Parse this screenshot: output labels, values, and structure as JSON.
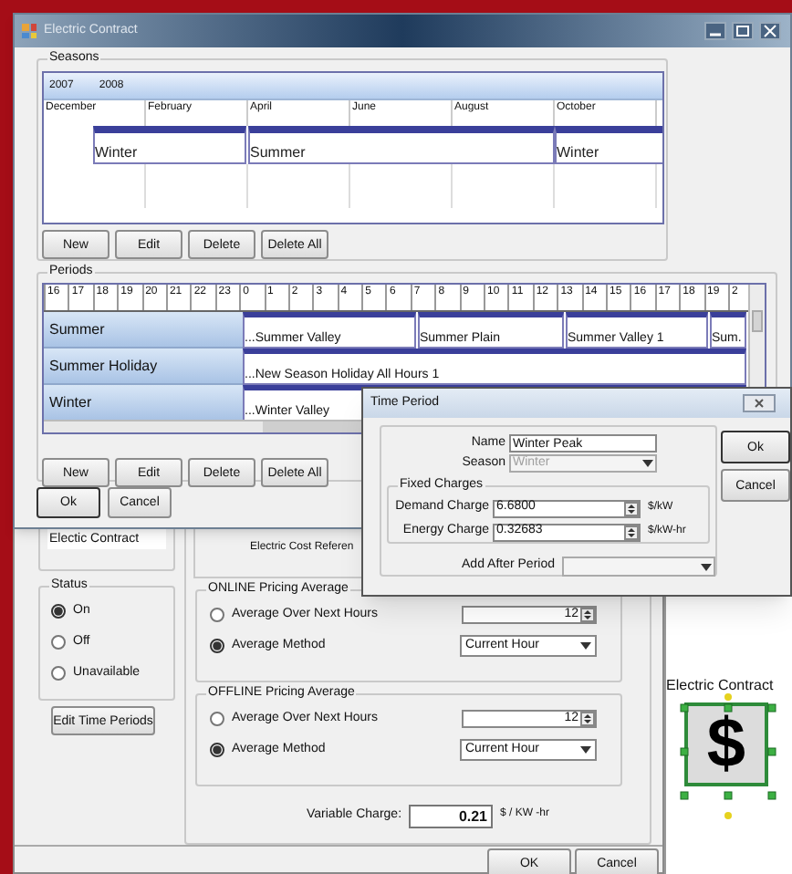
{
  "main_window": {
    "title": "Electric Contract",
    "seasons": {
      "label": "Seasons",
      "years": [
        "2007",
        "2008"
      ],
      "months": [
        "December",
        "February",
        "April",
        "June",
        "August",
        "October"
      ],
      "bars": [
        {
          "name": "Winter"
        },
        {
          "name": "Summer"
        },
        {
          "name": "Winter"
        }
      ],
      "buttons": [
        "New",
        "Edit",
        "Delete",
        "Delete All"
      ]
    },
    "periods": {
      "label": "Periods",
      "hours": [
        "16",
        "17",
        "18",
        "19",
        "20",
        "21",
        "22",
        "23",
        "0",
        "1",
        "2",
        "3",
        "4",
        "5",
        "6",
        "7",
        "8",
        "9",
        "10",
        "11",
        "12",
        "13",
        "14",
        "15",
        "16",
        "17",
        "18",
        "19",
        "2"
      ],
      "rows": [
        {
          "season": "Summer",
          "periods": [
            "...Summer Valley",
            "Summer Plain",
            "Summer Valley 1",
            "Sum."
          ]
        },
        {
          "season": "Summer Holiday",
          "periods": [
            "...New Season Holiday All Hours 1"
          ]
        },
        {
          "season": "Winter",
          "periods": [
            "...Winter Valley"
          ]
        }
      ],
      "buttons": [
        "New",
        "Edit",
        "Delete",
        "Delete All"
      ]
    },
    "buttons": [
      "Ok",
      "Cancel"
    ]
  },
  "back_window": {
    "name_value": "Electic Contract",
    "cost_reference": "Electric Cost Referen",
    "status": {
      "label": "Status",
      "options": [
        {
          "label": "On",
          "selected": true
        },
        {
          "label": "Off",
          "selected": false
        },
        {
          "label": "Unavailable",
          "selected": false
        }
      ]
    },
    "edit_button": "Edit Time Periods",
    "pricing": [
      {
        "label": "ONLINE Pricing Average",
        "options": [
          {
            "label": "Average Over Next Hours",
            "selected": false
          },
          {
            "label": "Average Method",
            "selected": true
          }
        ],
        "hours": "12",
        "method": "Current Hour"
      },
      {
        "label": "OFFLINE Pricing Average",
        "options": [
          {
            "label": "Average Over Next Hours",
            "selected": false
          },
          {
            "label": "Average Method",
            "selected": true
          }
        ],
        "hours": "12",
        "method": "Current Hour"
      }
    ],
    "variable_charge": {
      "label": "Variable Charge:",
      "value": "0.21",
      "unit": "$ / KW -hr"
    },
    "buttons": [
      "OK",
      "Cancel"
    ]
  },
  "time_period": {
    "title": "Time Period",
    "name": {
      "label": "Name",
      "value": "Winter Peak"
    },
    "season": {
      "label": "Season",
      "value": "Winter",
      "disabled": true
    },
    "fixed_charges": {
      "label": "Fixed Charges",
      "rows": [
        {
          "label": "Demand Charge",
          "value": "6.6800",
          "unit": "$/kW"
        },
        {
          "label": "Energy Charge",
          "value": "0.32683",
          "unit": "$/kW-hr"
        }
      ]
    },
    "add_after": {
      "label": "Add After Period"
    },
    "buttons": [
      "Ok",
      "Cancel"
    ]
  },
  "canvas": {
    "label": "Electric Contract",
    "symbol": "$"
  }
}
